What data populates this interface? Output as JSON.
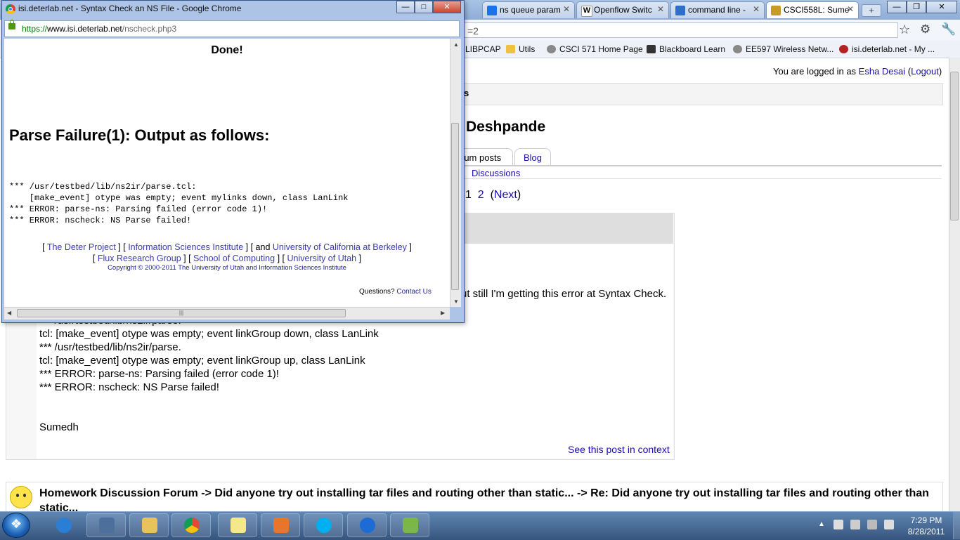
{
  "background_browser": {
    "tabs": [
      {
        "title": "ns queue param",
        "icon_color": "#1a73e8"
      },
      {
        "title": "Openflow Switc",
        "icon_color": "#ffffff"
      },
      {
        "title": "command line -",
        "icon_color": "#2f6fc7"
      },
      {
        "title": "CSCI558L: Sume",
        "icon_color": "#c69c25"
      }
    ],
    "new_tab_label": "+",
    "address_partial": "=2",
    "bookmarks": [
      {
        "label": "LIBPCAP",
        "icon_color": "#ffffff"
      },
      {
        "label": "Utils",
        "icon_color": "#f0c040"
      },
      {
        "label": "CSCI 571 Home Page",
        "icon_color": "#888888"
      },
      {
        "label": "Blackboard Learn",
        "icon_color": "#333333"
      },
      {
        "label": "EE597 Wireless Netw...",
        "icon_color": "#888888"
      },
      {
        "label": "isi.deterlab.net - My ...",
        "icon_color": "#b22222"
      }
    ],
    "page": {
      "login_prefix": "You are logged in as ",
      "login_user": "Esha Desai",
      "logout_open": " (",
      "logout_label": "Logout",
      "logout_close": ")",
      "navbar_partial": "s",
      "profile_name_partial": "Deshpande",
      "profile_tabs": [
        "rum posts",
        "Blog"
      ],
      "subnav_link": "Discussions",
      "pagination": {
        "pages": [
          "1",
          "2"
        ],
        "next_label": "Next",
        "open": "(",
        "close": ")"
      },
      "post_line_partial": "ut still I'm getting this error at Syntax Check.",
      "error_lines": [
        "*** /usr/testbed/lib/ns2ir/parse.",
        "tcl: [make_event] otype was empty; event linkGroup down, class LanLink",
        "*** /usr/testbed/lib/ns2ir/parse.",
        "tcl: [make_event] otype was empty; event linkGroup up, class LanLink",
        "*** ERROR: parse-ns: Parsing failed (error code 1)!",
        "*** ERROR: nscheck: NS Parse failed!"
      ],
      "signature": "Sumedh",
      "context_link": "See this post in context",
      "next_post_title": "Homework Discussion Forum -> Did anyone try out installing tar files and routing other than static... -> Re: Did anyone try out installing tar files and routing other than static..."
    }
  },
  "popup": {
    "window_title": "isi.deterlab.net - Syntax Check an NS File - Google Chrome",
    "url_scheme": "https://",
    "url_host": "www.isi.deterlab.net",
    "url_path": "/nscheck.php3",
    "done": "Done!",
    "heading": "Parse Failure(1): Output as follows:",
    "output_lines": [
      "*** /usr/testbed/lib/ns2ir/parse.tcl:",
      "    [make_event] otype was empty; event mylinks down, class LanLink",
      "*** ERROR: parse-ns: Parsing failed (error code 1)!",
      "*** ERROR: nscheck: NS Parse failed!"
    ],
    "footer": {
      "deter_project": "The Deter Project",
      "isi": "Information Sciences Institute",
      "and_text": "and",
      "berkeley": "University of California at Berkeley",
      "flux": "Flux Research Group",
      "soc": "School of Computing",
      "utah": "University of Utah",
      "copyright": "Copyright © 2000-2011 The University of Utah and Information Sciences Institute",
      "questions": "Questions?",
      "contact": "Contact Us"
    },
    "hscroll_grip": "|||"
  },
  "taskbar": {
    "time": "7:29 PM",
    "date": "8/28/2011",
    "apps": [
      {
        "name": "internet-explorer",
        "color": "#2a7fd4"
      },
      {
        "name": "network-app",
        "color": "#4d6f9c"
      },
      {
        "name": "windows-explorer",
        "color": "#e8c25a"
      },
      {
        "name": "google-chrome",
        "color": "#dd4b39"
      },
      {
        "name": "sticky-notes",
        "color": "#f3e98a"
      },
      {
        "name": "matlab",
        "color": "#e8752b"
      },
      {
        "name": "skype",
        "color": "#00aff0"
      },
      {
        "name": "teamviewer",
        "color": "#1e6bd6"
      },
      {
        "name": "notepad-plus",
        "color": "#7ab648"
      }
    ]
  }
}
